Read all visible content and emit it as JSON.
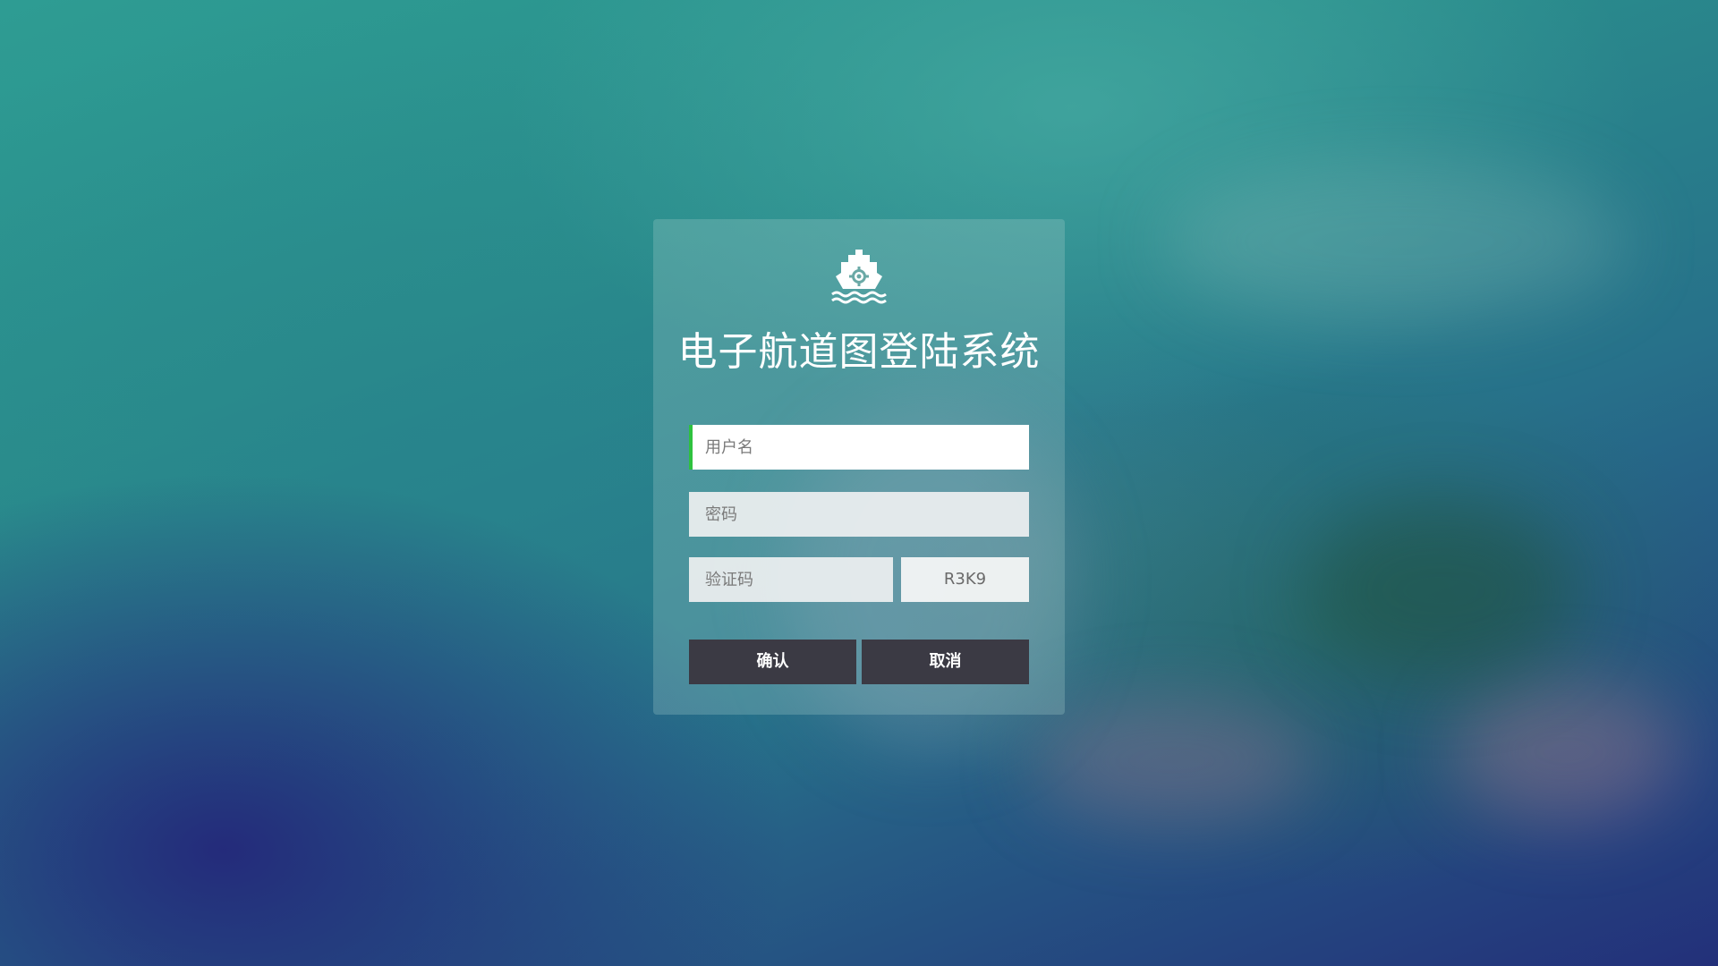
{
  "app": {
    "title": "电子航道图登陆系统",
    "logo_icon": "ship-icon"
  },
  "form": {
    "username_placeholder": "用户名",
    "password_placeholder": "密码",
    "captcha_placeholder": "验证码",
    "captcha_code": "R3K9",
    "confirm_label": "确认",
    "cancel_label": "取消"
  },
  "colors": {
    "active_field_accent": "#2ec23e",
    "button_background": "#3b3a44",
    "title_text": "#ffffff"
  }
}
